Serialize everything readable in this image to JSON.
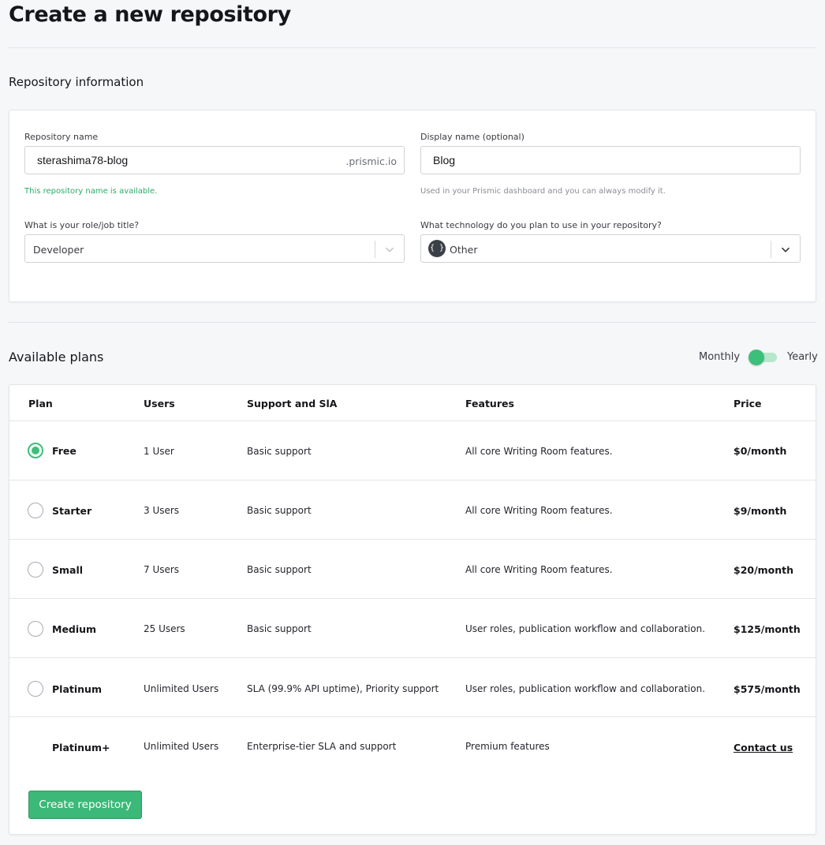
{
  "page": {
    "title": "Create a new repository"
  },
  "repo_info": {
    "section_title": "Repository information",
    "name_label": "Repository name",
    "name_value": "sterashima78-blog",
    "name_suffix": ".prismic.io",
    "name_hint": "This repository name is available.",
    "display_label": "Display name (optional)",
    "display_value": "Blog",
    "display_hint": "Used in your Prismic dashboard and you can always modify it.",
    "role_label": "What is your role/job title?",
    "role_value": "Developer",
    "tech_label": "What technology do you plan to use in your repository?",
    "tech_badge": "{ }",
    "tech_value": "Other"
  },
  "plans": {
    "section_title": "Available plans",
    "toggle_left": "Monthly",
    "toggle_right": "Yearly",
    "headers": {
      "plan": "Plan",
      "users": "Users",
      "support": "Support and SlA",
      "features": "Features",
      "price": "Price"
    },
    "rows": [
      {
        "plan": "Free",
        "users": "1 User",
        "support": "Basic support",
        "features": "All core Writing Room features.",
        "price": "$0/month",
        "selected": true
      },
      {
        "plan": "Starter",
        "users": "3 Users",
        "support": "Basic support",
        "features": "All core Writing Room features.",
        "price": "$9/month",
        "selected": false
      },
      {
        "plan": "Small",
        "users": "7 Users",
        "support": "Basic support",
        "features": "All core Writing Room features.",
        "price": "$20/month",
        "selected": false
      },
      {
        "plan": "Medium",
        "users": "25 Users",
        "support": "Basic support",
        "features": "User roles, publication workflow and collaboration.",
        "price": "$125/month",
        "selected": false
      },
      {
        "plan": "Platinum",
        "users": "Unlimited Users",
        "support": "SLA (99.9% API uptime), Priority support",
        "features": "User roles, publication workflow and collaboration.",
        "price": "$575/month",
        "selected": false
      },
      {
        "plan": "Platinum+",
        "users": "Unlimited Users",
        "support": "Enterprise-tier SLA and support",
        "features": "Premium features",
        "price": "Contact us",
        "selected": false
      }
    ],
    "create_button": "Create repository"
  },
  "colors": {
    "accent": "#3cbf7a",
    "link": "#1a0dab",
    "background": "#f6f7f9"
  }
}
